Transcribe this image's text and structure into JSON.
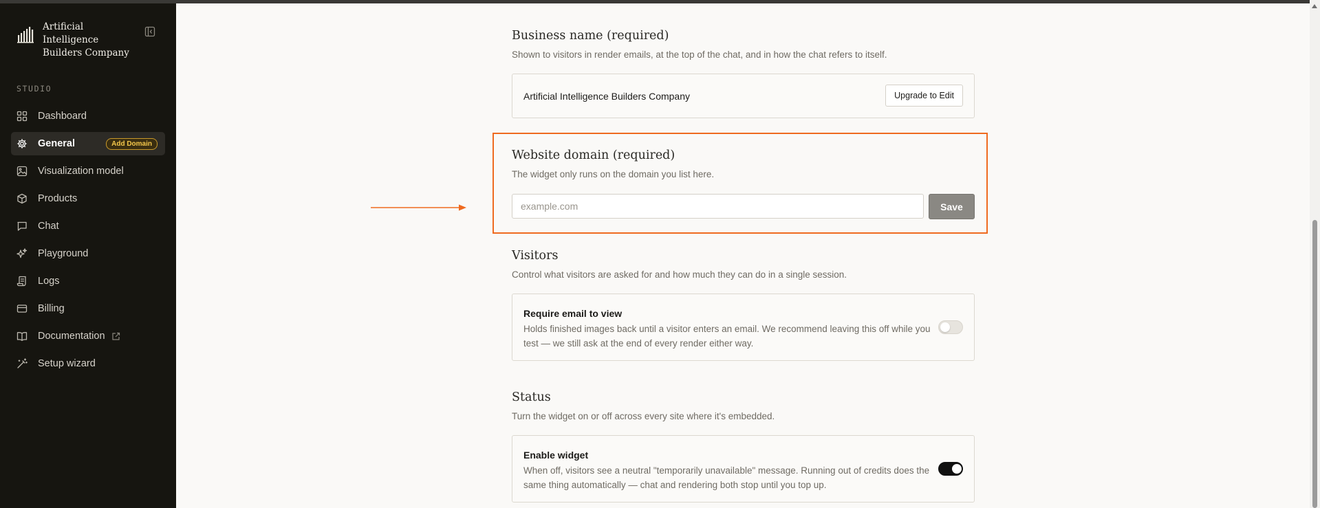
{
  "sidebar": {
    "brand_name": "Artificial Intelligence Builders Company",
    "section_label": "STUDIO",
    "items": [
      {
        "label": "Dashboard",
        "icon": "grid-icon"
      },
      {
        "label": "General",
        "icon": "gear-icon",
        "active": true,
        "badge": "Add Domain"
      },
      {
        "label": "Visualization model",
        "icon": "image-icon"
      },
      {
        "label": "Products",
        "icon": "box-icon"
      },
      {
        "label": "Chat",
        "icon": "chat-bubble-icon"
      },
      {
        "label": "Playground",
        "icon": "sparkles-icon"
      },
      {
        "label": "Logs",
        "icon": "scroll-icon"
      },
      {
        "label": "Billing",
        "icon": "credit-card-icon"
      },
      {
        "label": "Documentation",
        "icon": "book-icon",
        "external": true
      },
      {
        "label": "Setup wizard",
        "icon": "magic-wand-icon"
      }
    ]
  },
  "business": {
    "title": "Business name (required)",
    "description": "Shown to visitors in render emails, at the top of the chat, and in how the chat refers to itself.",
    "value": "Artificial Intelligence Builders Company",
    "upgrade_label": "Upgrade to Edit"
  },
  "domain": {
    "title": "Website domain (required)",
    "description": "The widget only runs on the domain you list here.",
    "placeholder": "example.com",
    "value": "",
    "save_label": "Save"
  },
  "visitors": {
    "title": "Visitors",
    "description": "Control what visitors are asked for and how much they can do in a single session.",
    "setting_title": "Require email to view",
    "setting_text": "Holds finished images back until a visitor enters an email. We recommend leaving this off while you test — we still ask at the end of every render either way.",
    "enabled": false
  },
  "status": {
    "title": "Status",
    "description": "Turn the widget on or off across every site where it's embedded.",
    "setting_title": "Enable widget",
    "setting_text": "When off, visitors see a neutral \"temporarily unavailable\" message. Running out of credits does the same thing automatically — chat and rendering both stop until you top up.",
    "enabled": true
  },
  "colors": {
    "sidebar_bg": "#161510",
    "accent_orange": "#ef6a1f",
    "badge_yellow": "#f5c84b",
    "save_button": "#8a8883"
  }
}
